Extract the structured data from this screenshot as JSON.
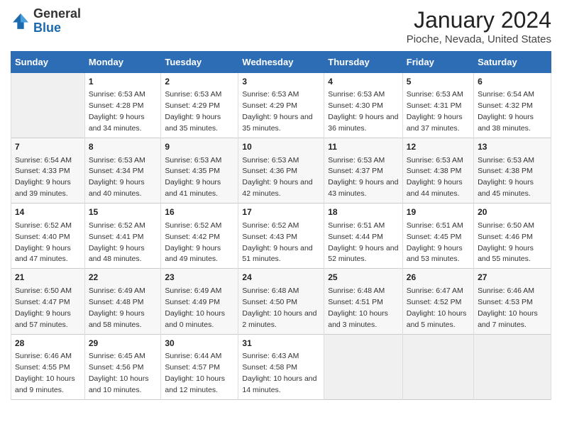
{
  "logo": {
    "general": "General",
    "blue": "Blue"
  },
  "title": "January 2024",
  "subtitle": "Pioche, Nevada, United States",
  "days_of_week": [
    "Sunday",
    "Monday",
    "Tuesday",
    "Wednesday",
    "Thursday",
    "Friday",
    "Saturday"
  ],
  "weeks": [
    [
      {
        "day": "",
        "sunrise": "",
        "sunset": "",
        "daylight": ""
      },
      {
        "day": "1",
        "sunrise": "Sunrise: 6:53 AM",
        "sunset": "Sunset: 4:28 PM",
        "daylight": "Daylight: 9 hours and 34 minutes."
      },
      {
        "day": "2",
        "sunrise": "Sunrise: 6:53 AM",
        "sunset": "Sunset: 4:29 PM",
        "daylight": "Daylight: 9 hours and 35 minutes."
      },
      {
        "day": "3",
        "sunrise": "Sunrise: 6:53 AM",
        "sunset": "Sunset: 4:29 PM",
        "daylight": "Daylight: 9 hours and 35 minutes."
      },
      {
        "day": "4",
        "sunrise": "Sunrise: 6:53 AM",
        "sunset": "Sunset: 4:30 PM",
        "daylight": "Daylight: 9 hours and 36 minutes."
      },
      {
        "day": "5",
        "sunrise": "Sunrise: 6:53 AM",
        "sunset": "Sunset: 4:31 PM",
        "daylight": "Daylight: 9 hours and 37 minutes."
      },
      {
        "day": "6",
        "sunrise": "Sunrise: 6:54 AM",
        "sunset": "Sunset: 4:32 PM",
        "daylight": "Daylight: 9 hours and 38 minutes."
      }
    ],
    [
      {
        "day": "7",
        "sunrise": "Sunrise: 6:54 AM",
        "sunset": "Sunset: 4:33 PM",
        "daylight": "Daylight: 9 hours and 39 minutes."
      },
      {
        "day": "8",
        "sunrise": "Sunrise: 6:53 AM",
        "sunset": "Sunset: 4:34 PM",
        "daylight": "Daylight: 9 hours and 40 minutes."
      },
      {
        "day": "9",
        "sunrise": "Sunrise: 6:53 AM",
        "sunset": "Sunset: 4:35 PM",
        "daylight": "Daylight: 9 hours and 41 minutes."
      },
      {
        "day": "10",
        "sunrise": "Sunrise: 6:53 AM",
        "sunset": "Sunset: 4:36 PM",
        "daylight": "Daylight: 9 hours and 42 minutes."
      },
      {
        "day": "11",
        "sunrise": "Sunrise: 6:53 AM",
        "sunset": "Sunset: 4:37 PM",
        "daylight": "Daylight: 9 hours and 43 minutes."
      },
      {
        "day": "12",
        "sunrise": "Sunrise: 6:53 AM",
        "sunset": "Sunset: 4:38 PM",
        "daylight": "Daylight: 9 hours and 44 minutes."
      },
      {
        "day": "13",
        "sunrise": "Sunrise: 6:53 AM",
        "sunset": "Sunset: 4:38 PM",
        "daylight": "Daylight: 9 hours and 45 minutes."
      }
    ],
    [
      {
        "day": "14",
        "sunrise": "Sunrise: 6:52 AM",
        "sunset": "Sunset: 4:40 PM",
        "daylight": "Daylight: 9 hours and 47 minutes."
      },
      {
        "day": "15",
        "sunrise": "Sunrise: 6:52 AM",
        "sunset": "Sunset: 4:41 PM",
        "daylight": "Daylight: 9 hours and 48 minutes."
      },
      {
        "day": "16",
        "sunrise": "Sunrise: 6:52 AM",
        "sunset": "Sunset: 4:42 PM",
        "daylight": "Daylight: 9 hours and 49 minutes."
      },
      {
        "day": "17",
        "sunrise": "Sunrise: 6:52 AM",
        "sunset": "Sunset: 4:43 PM",
        "daylight": "Daylight: 9 hours and 51 minutes."
      },
      {
        "day": "18",
        "sunrise": "Sunrise: 6:51 AM",
        "sunset": "Sunset: 4:44 PM",
        "daylight": "Daylight: 9 hours and 52 minutes."
      },
      {
        "day": "19",
        "sunrise": "Sunrise: 6:51 AM",
        "sunset": "Sunset: 4:45 PM",
        "daylight": "Daylight: 9 hours and 53 minutes."
      },
      {
        "day": "20",
        "sunrise": "Sunrise: 6:50 AM",
        "sunset": "Sunset: 4:46 PM",
        "daylight": "Daylight: 9 hours and 55 minutes."
      }
    ],
    [
      {
        "day": "21",
        "sunrise": "Sunrise: 6:50 AM",
        "sunset": "Sunset: 4:47 PM",
        "daylight": "Daylight: 9 hours and 57 minutes."
      },
      {
        "day": "22",
        "sunrise": "Sunrise: 6:49 AM",
        "sunset": "Sunset: 4:48 PM",
        "daylight": "Daylight: 9 hours and 58 minutes."
      },
      {
        "day": "23",
        "sunrise": "Sunrise: 6:49 AM",
        "sunset": "Sunset: 4:49 PM",
        "daylight": "Daylight: 10 hours and 0 minutes."
      },
      {
        "day": "24",
        "sunrise": "Sunrise: 6:48 AM",
        "sunset": "Sunset: 4:50 PM",
        "daylight": "Daylight: 10 hours and 2 minutes."
      },
      {
        "day": "25",
        "sunrise": "Sunrise: 6:48 AM",
        "sunset": "Sunset: 4:51 PM",
        "daylight": "Daylight: 10 hours and 3 minutes."
      },
      {
        "day": "26",
        "sunrise": "Sunrise: 6:47 AM",
        "sunset": "Sunset: 4:52 PM",
        "daylight": "Daylight: 10 hours and 5 minutes."
      },
      {
        "day": "27",
        "sunrise": "Sunrise: 6:46 AM",
        "sunset": "Sunset: 4:53 PM",
        "daylight": "Daylight: 10 hours and 7 minutes."
      }
    ],
    [
      {
        "day": "28",
        "sunrise": "Sunrise: 6:46 AM",
        "sunset": "Sunset: 4:55 PM",
        "daylight": "Daylight: 10 hours and 9 minutes."
      },
      {
        "day": "29",
        "sunrise": "Sunrise: 6:45 AM",
        "sunset": "Sunset: 4:56 PM",
        "daylight": "Daylight: 10 hours and 10 minutes."
      },
      {
        "day": "30",
        "sunrise": "Sunrise: 6:44 AM",
        "sunset": "Sunset: 4:57 PM",
        "daylight": "Daylight: 10 hours and 12 minutes."
      },
      {
        "day": "31",
        "sunrise": "Sunrise: 6:43 AM",
        "sunset": "Sunset: 4:58 PM",
        "daylight": "Daylight: 10 hours and 14 minutes."
      },
      {
        "day": "",
        "sunrise": "",
        "sunset": "",
        "daylight": ""
      },
      {
        "day": "",
        "sunrise": "",
        "sunset": "",
        "daylight": ""
      },
      {
        "day": "",
        "sunrise": "",
        "sunset": "",
        "daylight": ""
      }
    ]
  ]
}
